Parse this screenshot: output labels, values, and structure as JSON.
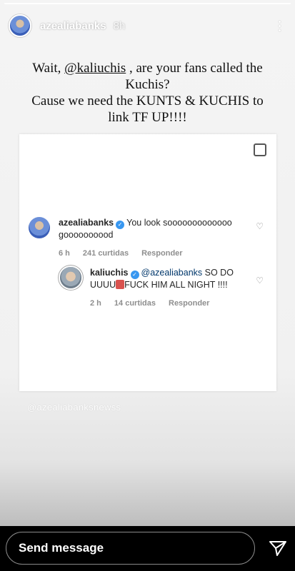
{
  "story": {
    "username": "azealiabanks",
    "time": "8h"
  },
  "caption": {
    "line1_prefix": "Wait, ",
    "mention": "@kaliuchis",
    "line1_suffix": " , are your fans called the Kuchis?",
    "line2": "Cause we need the KUNTS & KUCHIS to link TF UP!!!!"
  },
  "comments": [
    {
      "user": "azealiabanks",
      "text": "You look sooooooooooooo goooooooood",
      "time": "6 h",
      "likes": "241 curtidas",
      "reply": "Responder"
    },
    {
      "user": "kaliuchis",
      "mention": "@azealiabanks",
      "text_before": " SO DO UUUU",
      "text_after": "FUCK HIM ALL NIGHT !!!!",
      "time": "2 h",
      "likes": "14 curtidas",
      "reply": "Responder"
    }
  ],
  "watermark": "@azealiabanksnewss",
  "footer": {
    "send_placeholder": "Send message"
  },
  "colors": {
    "verified": "#3897f0",
    "mention": "#00376b"
  }
}
